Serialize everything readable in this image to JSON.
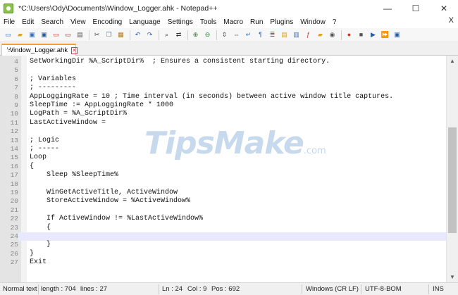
{
  "window": {
    "title": "*C:\\Users\\Ody\\Documents\\Window_Logger.ahk - Notepad++",
    "minimize_glyph": "—",
    "maximize_glyph": "☐",
    "close_glyph": "✕"
  },
  "menu": {
    "items": [
      "File",
      "Edit",
      "Search",
      "View",
      "Encoding",
      "Language",
      "Settings",
      "Tools",
      "Macro",
      "Run",
      "Plugins",
      "Window",
      "?"
    ],
    "close_glyph": "X"
  },
  "toolbar": {
    "icons": [
      {
        "name": "new-file-icon",
        "glyph": "▭",
        "color": "#3b6fb6"
      },
      {
        "name": "open-file-icon",
        "glyph": "▰",
        "color": "#d9a520"
      },
      {
        "name": "save-icon",
        "glyph": "▣",
        "color": "#3b6fb6"
      },
      {
        "name": "save-all-icon",
        "glyph": "▣",
        "color": "#2a5aa0"
      },
      {
        "name": "close-file-icon",
        "glyph": "▭",
        "color": "#c0392b"
      },
      {
        "name": "close-all-icon",
        "glyph": "▭",
        "color": "#a02a1f"
      },
      {
        "name": "print-icon",
        "glyph": "▤",
        "color": "#555555"
      },
      {
        "name": "separator"
      },
      {
        "name": "cut-icon",
        "glyph": "✂",
        "color": "#444444"
      },
      {
        "name": "copy-icon",
        "glyph": "❐",
        "color": "#3b6fb6"
      },
      {
        "name": "paste-icon",
        "glyph": "▦",
        "color": "#b57a1f"
      },
      {
        "name": "separator"
      },
      {
        "name": "undo-icon",
        "glyph": "↶",
        "color": "#2a5aa0"
      },
      {
        "name": "redo-icon",
        "glyph": "↷",
        "color": "#2a5aa0"
      },
      {
        "name": "separator"
      },
      {
        "name": "find-icon",
        "glyph": "⌕",
        "color": "#333333"
      },
      {
        "name": "replace-icon",
        "glyph": "⇄",
        "color": "#333333"
      },
      {
        "name": "separator"
      },
      {
        "name": "zoom-in-icon",
        "glyph": "⊕",
        "color": "#2a7a2a"
      },
      {
        "name": "zoom-out-icon",
        "glyph": "⊖",
        "color": "#2a7a2a"
      },
      {
        "name": "separator"
      },
      {
        "name": "sync-vertical-icon",
        "glyph": "⇕",
        "color": "#555555"
      },
      {
        "name": "sync-horizontal-icon",
        "glyph": "⇔",
        "color": "#555555"
      },
      {
        "name": "word-wrap-icon",
        "glyph": "↵",
        "color": "#3b6fb6"
      },
      {
        "name": "show-all-chars-icon",
        "glyph": "¶",
        "color": "#3b6fb6"
      },
      {
        "name": "indent-guide-icon",
        "glyph": "≣",
        "color": "#3b6fb6"
      },
      {
        "name": "user-defined-language-icon",
        "glyph": "▤",
        "color": "#d9a520"
      },
      {
        "name": "document-map-icon",
        "glyph": "▥",
        "color": "#3b6fb6"
      },
      {
        "name": "function-list-icon",
        "glyph": "ƒ",
        "color": "#c0392b"
      },
      {
        "name": "folder-as-workspace-icon",
        "glyph": "▰",
        "color": "#d9a520"
      },
      {
        "name": "monitoring-icon",
        "glyph": "◉",
        "color": "#555555"
      },
      {
        "name": "separator"
      },
      {
        "name": "record-macro-icon",
        "glyph": "●",
        "color": "#c0392b"
      },
      {
        "name": "stop-recording-icon",
        "glyph": "■",
        "color": "#555555"
      },
      {
        "name": "playback-macro-icon",
        "glyph": "▶",
        "color": "#2a5aa0"
      },
      {
        "name": "run-macro-multiple-icon",
        "glyph": "⏩",
        "color": "#2a5aa0"
      },
      {
        "name": "save-macro-icon",
        "glyph": "▣",
        "color": "#2a5aa0"
      }
    ]
  },
  "tab": {
    "label": "Window_Logger.ahk",
    "close_glyph": "✕"
  },
  "editor": {
    "current_line": 24,
    "lines": [
      {
        "n": "4",
        "text": "SetWorkingDir %A_ScriptDir%  ; Ensures a consistent starting directory."
      },
      {
        "n": "5",
        "text": ""
      },
      {
        "n": "6",
        "text": "; Variables"
      },
      {
        "n": "7",
        "text": "; ---------"
      },
      {
        "n": "8",
        "text": "AppLoggingRate = 10 ; Time interval (in seconds) between active window title captures."
      },
      {
        "n": "9",
        "text": "SleepTime := AppLoggingRate * 1000"
      },
      {
        "n": "10",
        "text": "LogPath = %A_ScriptDir%"
      },
      {
        "n": "11",
        "text": "LastActiveWindow ="
      },
      {
        "n": "12",
        "text": ""
      },
      {
        "n": "13",
        "text": "; Logic"
      },
      {
        "n": "14",
        "text": "; -----"
      },
      {
        "n": "15",
        "text": "Loop"
      },
      {
        "n": "16",
        "text": "{"
      },
      {
        "n": "17",
        "text": "    Sleep %SleepTime%"
      },
      {
        "n": "18",
        "text": ""
      },
      {
        "n": "19",
        "text": "    WinGetActiveTitle, ActiveWindow"
      },
      {
        "n": "20",
        "text": "    StoreActiveWindow = %ActiveWindow%"
      },
      {
        "n": "21",
        "text": ""
      },
      {
        "n": "22",
        "text": "    If ActiveWindow != %LastActiveWindow%"
      },
      {
        "n": "23",
        "text": "    {"
      },
      {
        "n": "24",
        "text": ""
      },
      {
        "n": "25",
        "text": "    }"
      },
      {
        "n": "26",
        "text": "}"
      },
      {
        "n": "27",
        "text": "Exit"
      }
    ]
  },
  "watermark": {
    "brand": "TipsMake",
    "suffix": ".com"
  },
  "status": {
    "file_type": "Normal text",
    "length": "length : 704",
    "lines": "lines : 27",
    "ln": "Ln : 24",
    "col": "Col : 9",
    "pos": "Pos : 692",
    "eol": "Windows (CR LF)",
    "encoding": "UTF-8-BOM",
    "mode": "INS"
  }
}
